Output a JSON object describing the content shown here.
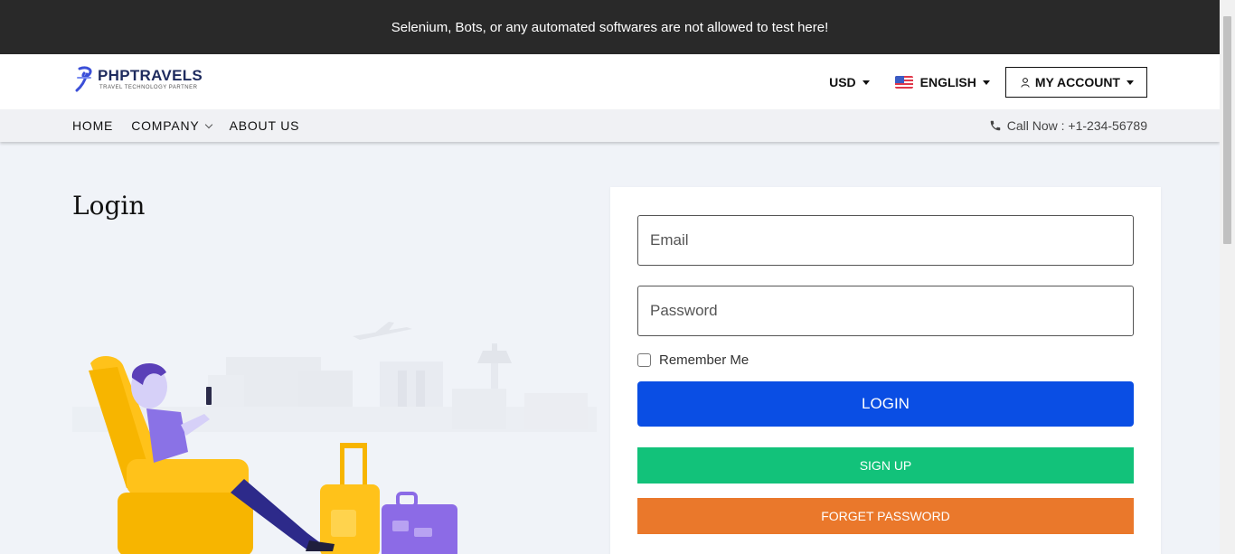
{
  "banner": {
    "text": "Selenium, Bots, or any automated softwares are not allowed to test here!"
  },
  "header": {
    "logo_name": "PHPTRAVELS",
    "logo_tagline": "TRAVEL TECHNOLOGY PARTNER",
    "currency": "USD",
    "language": "ENGLISH",
    "account": "MY ACCOUNT"
  },
  "nav": {
    "items": [
      {
        "label": "HOME"
      },
      {
        "label": "COMPANY"
      },
      {
        "label": "ABOUT US"
      }
    ],
    "call": "Call Now : +1-234-56789"
  },
  "page": {
    "title": "Login"
  },
  "form": {
    "email_placeholder": "Email",
    "password_placeholder": "Password",
    "remember_label": "Remember Me",
    "login_label": "LOGIN",
    "signup_label": "SIGN UP",
    "forget_label": "FORGET PASSWORD"
  },
  "colors": {
    "banner_bg": "#292929",
    "login_button": "#0a4ee4",
    "signup_button": "#12c27a",
    "forget_button": "#ea782b",
    "page_bg": "#f0f3f8"
  },
  "icons": {
    "logo": "phptravels-logo-icon",
    "currency_caret": "caret-down-icon",
    "language_flag": "us-flag-icon",
    "account_user": "user-icon",
    "company_chevron": "chevron-down-icon",
    "phone": "phone-icon"
  }
}
